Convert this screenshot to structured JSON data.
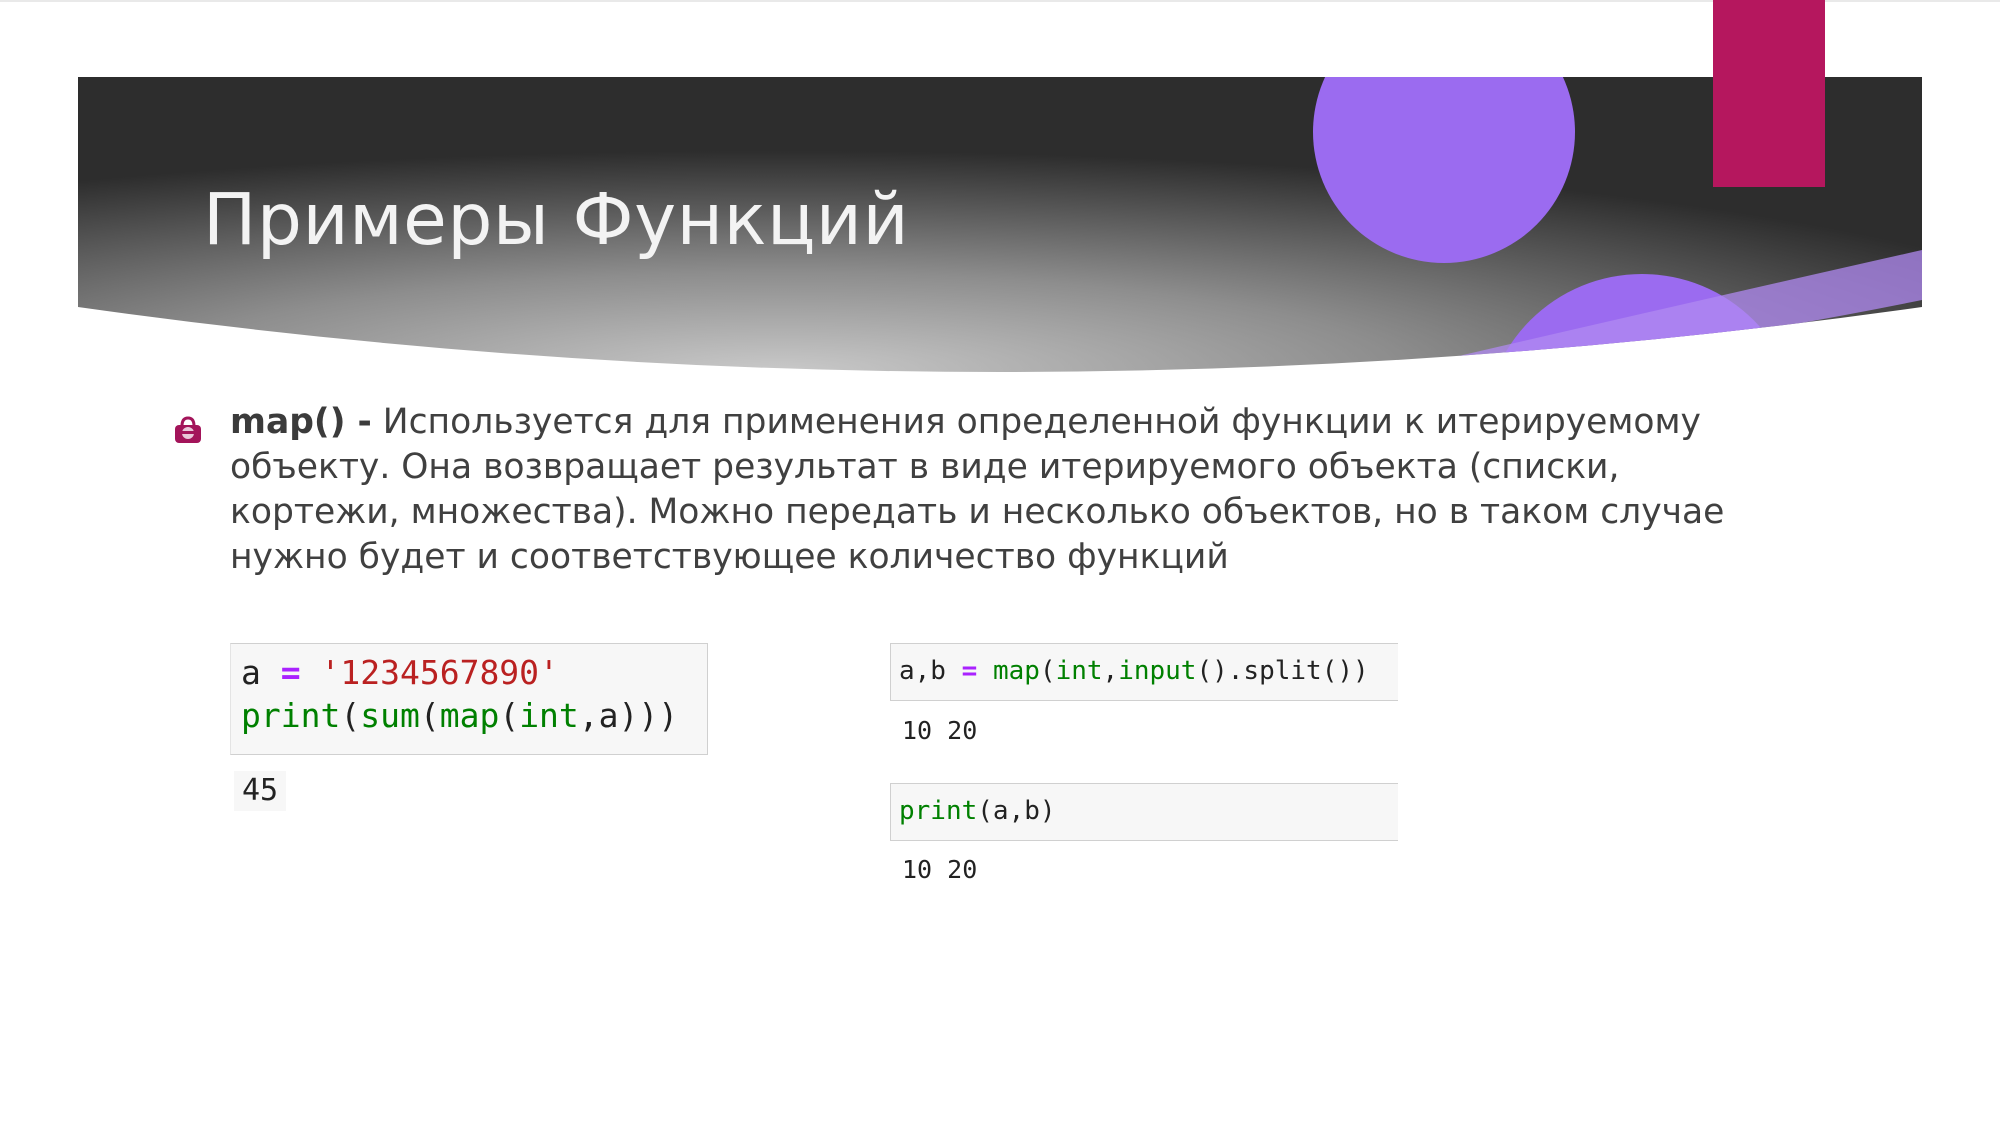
{
  "slide": {
    "title": "Примеры Функций",
    "colors": {
      "banner_dark": "#2f2f2f",
      "banner_light": "#c4c4c4",
      "purple_accent": "#9a6cf0",
      "magenta_accent": "#b5175e"
    }
  },
  "bullet": {
    "icon": "bag-bullet-icon",
    "term": "map() -",
    "text": " Используется для применения определенной функции к итерируемому объекту. Она возвращает результат в виде итерируемого объекта (списки, кортежи, множества). Можно передать и несколько объектов, но в таком случае нужно будет и соответствующее количество функций"
  },
  "example1": {
    "line1": {
      "var": "a",
      "op": "=",
      "str": "'1234567890'"
    },
    "line2": {
      "fn1": "print",
      "p1": "(",
      "fn2": "sum",
      "p2": "(",
      "fn3": "map",
      "p3": "(",
      "fn4": "int",
      "rest": ",a)))"
    },
    "output": "45"
  },
  "example2": {
    "cell1": {
      "vars": "a,b",
      "op": "=",
      "fn1": "map",
      "p1": "(",
      "fn2": "int",
      "p2": ",",
      "fn3": "input",
      "rest": "().split())"
    },
    "output1": "10 20",
    "cell2": {
      "fn": "print",
      "rest": "(a,b)"
    },
    "output2": "10 20"
  }
}
